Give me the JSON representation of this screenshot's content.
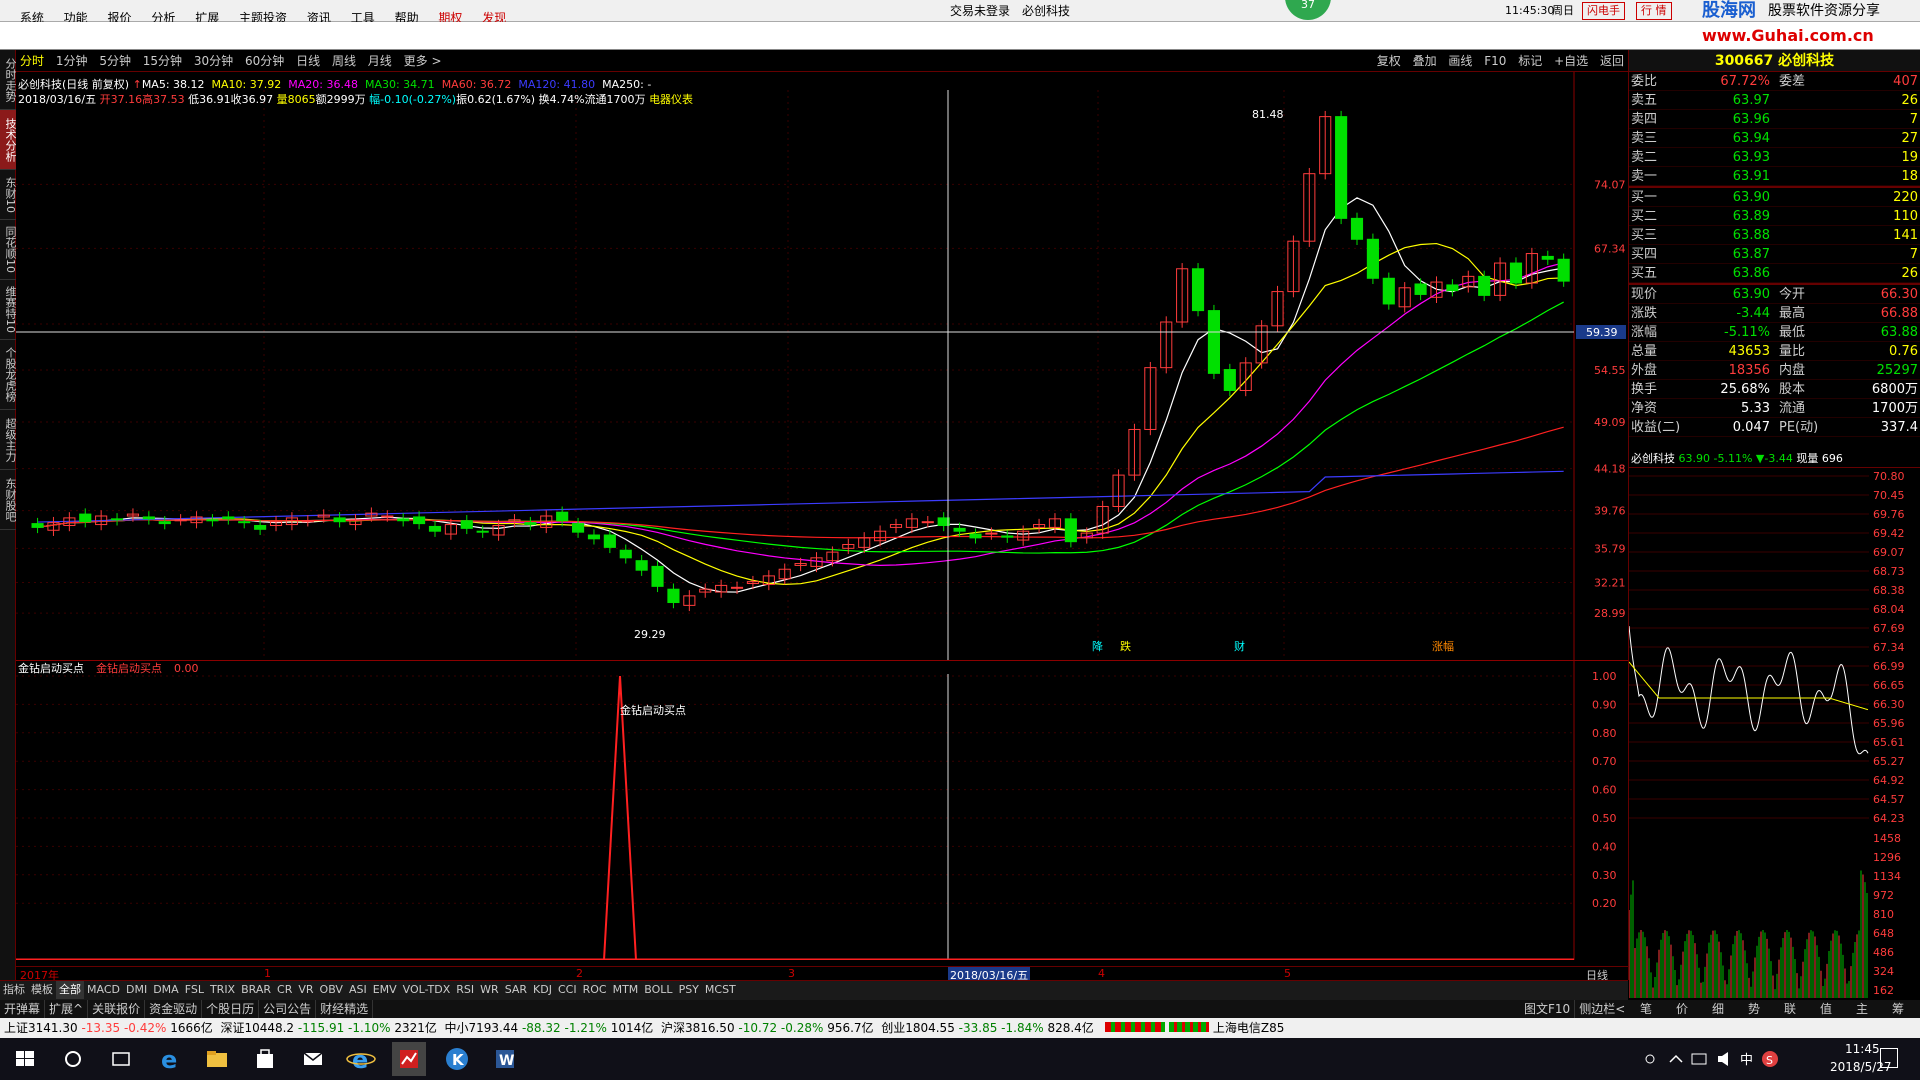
{
  "menu": {
    "items": [
      "系统",
      "功能",
      "报价",
      "分析",
      "扩展",
      "主题投资",
      "资讯",
      "工具",
      "帮助"
    ],
    "special": [
      "期权",
      "发现"
    ],
    "login": "交易未登录",
    "stock": "必创科技",
    "badge": "37",
    "time": "11:45:30",
    "weekday": "周日",
    "btn1": "闪电手",
    "btn2": "行 情"
  },
  "logo": {
    "main": "股海网",
    "sub": "股票软件资源分享",
    "url": "www.Guhai.com.cn"
  },
  "periods": [
    "分时",
    "1分钟",
    "5分钟",
    "15分钟",
    "30分钟",
    "60分钟",
    "日线",
    "周线",
    "月线",
    "更多 >"
  ],
  "toolbar_right": [
    "复权",
    "叠加",
    "画线",
    "F10",
    "标记",
    "+自选",
    "返回"
  ],
  "left_tabs": [
    "分时走势",
    "技术分析",
    "东财10",
    "同花顺10",
    "维赛特10",
    "个股龙虎榜",
    "超级主力",
    "东财股吧"
  ],
  "info": {
    "title": "必创科技(日线 前复权)",
    "ma": [
      {
        "label": "MA5: 38.12",
        "color": "#ffffff"
      },
      {
        "label": "MA10: 37.92",
        "color": "#ffff00"
      },
      {
        "label": "MA20: 36.48",
        "color": "#ff00ff"
      },
      {
        "label": "MA30: 34.71",
        "color": "#00ff00"
      },
      {
        "label": "MA60: 36.72",
        "color": "#ff0000"
      },
      {
        "label": "MA120: 41.80",
        "color": "#3c3cff"
      },
      {
        "label": "MA250: -",
        "color": "#ffffff"
      }
    ],
    "date": "2018/03/16/五",
    "open": "开37.16",
    "high": "高37.53",
    "low": "低36.91",
    "close": "收36.97",
    "vol": "量8065",
    "amt": "额2999万",
    "chg": "幅-0.10(-0.27%)",
    "amp": "振0.62(1.67%)",
    "turn": "换4.74%",
    "float": "流通1700万",
    "sector": "电器仪表"
  },
  "price_axis": [
    "74.07",
    "67.34",
    "59.39",
    "54.55",
    "49.09",
    "44.18",
    "39.76",
    "35.79",
    "32.21",
    "28.99"
  ],
  "high_label": "81.48",
  "low_label": "29.29",
  "events": [
    "降",
    "跌",
    "财",
    "涨幅"
  ],
  "indicator": {
    "name": "金钻启动买点",
    "label": "金钻启动买点",
    "value": "0.00",
    "peak_label": "金钻启动买点",
    "axis": [
      "1.00",
      "0.90",
      "0.80",
      "0.70",
      "0.60",
      "0.50",
      "0.40",
      "0.30",
      "0.20"
    ]
  },
  "xaxis": {
    "labels": [
      "2017年",
      "1",
      "2",
      "3",
      "4",
      "5"
    ],
    "cursor": "2018/03/16/五",
    "period": "日线"
  },
  "bottom_tabs": [
    "指标",
    "模板",
    "全部",
    "MACD",
    "DMI",
    "DMA",
    "FSL",
    "TRIX",
    "BRAR",
    "CR",
    "VR",
    "OBV",
    "ASI",
    "EMV",
    "VOL-TDX",
    "RSI",
    "WR",
    "SAR",
    "KDJ",
    "CCI",
    "ROC",
    "MTM",
    "BOLL",
    "PSY",
    "MCST"
  ],
  "bottom_tabs2": [
    "开弹幕",
    "扩展^",
    "关联报价",
    "资金驱动",
    "个股日历",
    "公司公告",
    "财经精选"
  ],
  "bottom_right": [
    "图文F10",
    "侧边栏<"
  ],
  "quote": {
    "code": "300667",
    "name": "必创科技",
    "weibi_label": "委比",
    "weibi": "67.72%",
    "weicha_label": "委差",
    "weicha": "407",
    "sells": [
      {
        "label": "卖五",
        "price": "63.97",
        "vol": "26"
      },
      {
        "label": "卖四",
        "price": "63.96",
        "vol": "7"
      },
      {
        "label": "卖三",
        "price": "63.94",
        "vol": "27"
      },
      {
        "label": "卖二",
        "price": "63.93",
        "vol": "19"
      },
      {
        "label": "卖一",
        "price": "63.91",
        "vol": "18"
      }
    ],
    "buys": [
      {
        "label": "买一",
        "price": "63.90",
        "vol": "220"
      },
      {
        "label": "买二",
        "price": "63.89",
        "vol": "110"
      },
      {
        "label": "买三",
        "price": "63.88",
        "vol": "141"
      },
      {
        "label": "买四",
        "price": "63.87",
        "vol": "7"
      },
      {
        "label": "买五",
        "price": "63.86",
        "vol": "26"
      }
    ],
    "stats": [
      {
        "l1": "现价",
        "v1": "63.90",
        "l2": "今开",
        "v2": "66.30"
      },
      {
        "l1": "涨跌",
        "v1": "-3.44",
        "l2": "最高",
        "v2": "66.88"
      },
      {
        "l1": "涨幅",
        "v1": "-5.11%",
        "l2": "最低",
        "v2": "63.88"
      },
      {
        "l1": "总量",
        "v1": "43653",
        "l2": "量比",
        "v2": "0.76"
      },
      {
        "l1": "外盘",
        "v1": "18356",
        "l2": "内盘",
        "v2": "25297"
      },
      {
        "l1": "换手",
        "v1": "25.68%",
        "l2": "股本",
        "v2": "6800万"
      },
      {
        "l1": "净资",
        "v1": "5.33",
        "l2": "流通",
        "v2": "1700万"
      },
      {
        "l1": "收益(二)",
        "v1": "0.047",
        "l2": "PE(动)",
        "v2": "337.4"
      }
    ],
    "mini_title": "必创科技",
    "mini_price": "63.90",
    "mini_pct": "-5.11%",
    "mini_chg": "▼-3.44",
    "mini_vol": "现量 696",
    "mini_axis": [
      "70.80",
      "70.45",
      "69.76",
      "69.42",
      "69.07",
      "68.73",
      "68.38",
      "68.04",
      "67.69",
      "67.34",
      "66.99",
      "66.65",
      "66.30",
      "65.96",
      "65.61",
      "65.27",
      "64.92",
      "64.57",
      "64.23"
    ],
    "mini_vol_axis": [
      "1458",
      "1296",
      "1134",
      "972",
      "810",
      "648",
      "486",
      "324",
      "162"
    ],
    "mini_tabs": [
      "笔",
      "价",
      "细",
      "势",
      "联",
      "值",
      "主",
      "筹"
    ]
  },
  "status": {
    "sh": "上证3141.30",
    "sh_chg": "-13.35",
    "sh_pct": "-0.42%",
    "sh_amt": "1666亿",
    "sz": "深证10448.2",
    "sz_chg": "-115.91",
    "sz_pct": "-1.10%",
    "sz_amt": "2321亿",
    "zx": "中小7193.44",
    "zx_chg": "-88.32",
    "zx_pct": "-1.21%",
    "zx_amt": "1014亿",
    "hs": "沪深3816.50",
    "hs_chg": "-10.72",
    "hs_pct": "-0.28%",
    "hs_amt": "956.7亿",
    "cy": "创业1804.55",
    "cy_chg": "-33.85",
    "cy_pct": "-1.84%",
    "cy_amt": "828.4亿",
    "isp": "上海电信Z85"
  },
  "taskbar": {
    "time": "11:45",
    "date": "2018/5/27"
  },
  "colors": {
    "up": "#ff3c3c",
    "down": "#00e000",
    "bg": "#000000",
    "grid": "#600000"
  }
}
